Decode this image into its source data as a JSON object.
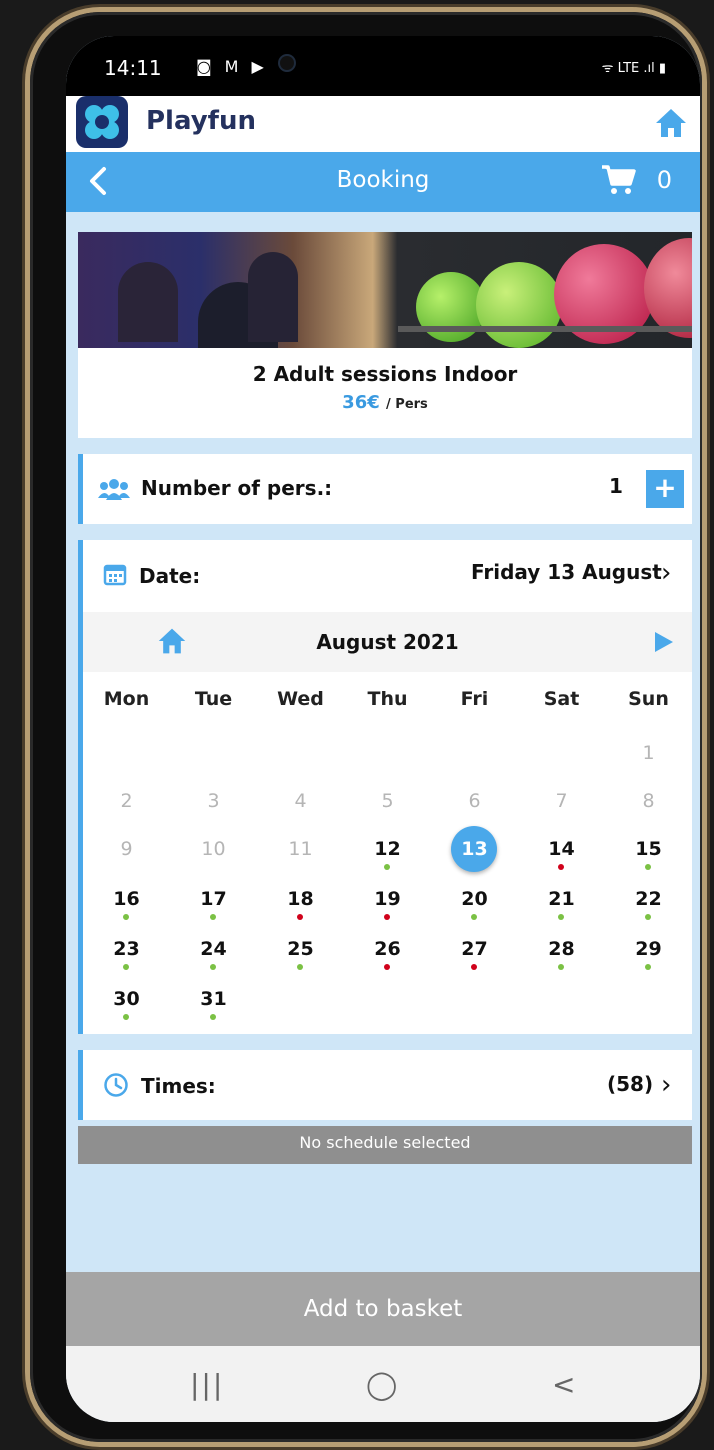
{
  "status_bar": {
    "time": "14:11",
    "notif_icons": "◙ M ▶",
    "right": "ᯤ LTE .ıl ▮"
  },
  "app": {
    "name": "Playfun"
  },
  "nav": {
    "title": "Booking",
    "cart_count": "0"
  },
  "product": {
    "name": "2 Adult sessions Indoor",
    "price": "36€",
    "price_unit": "/ Pers"
  },
  "persons": {
    "label": "Number of pers.:",
    "value": "1",
    "plus": "+"
  },
  "date": {
    "label": "Date:",
    "value": "Friday 13 August",
    "chevron": "›"
  },
  "calendar": {
    "month": "August 2021",
    "weekdays": [
      "Mon",
      "Tue",
      "Wed",
      "Thu",
      "Fri",
      "Sat",
      "Sun"
    ],
    "selected_day": "13",
    "dot_colors": {
      "green": "#7bc144",
      "red": "#d0021b"
    }
  },
  "times": {
    "label": "Times:",
    "count": "(58)",
    "chevron": "›"
  },
  "schedule_status": "No schedule selected",
  "add_to_basket": "Add to basket",
  "system_nav": {
    "recents": "|||",
    "home": "◯",
    "back": "<"
  }
}
